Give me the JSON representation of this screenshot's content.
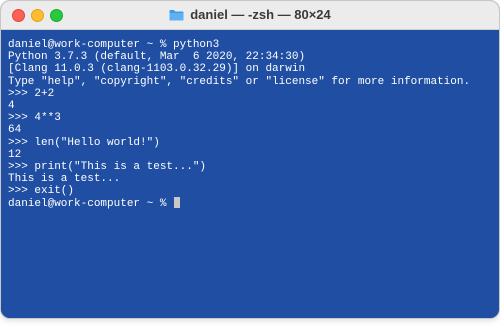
{
  "window": {
    "title": "daniel — -zsh — 80×24",
    "title_icon": "folder-icon",
    "background_color": "#1f4ea3",
    "text_color": "#ffffff"
  },
  "terminal": {
    "lines": [
      "daniel@work-computer ~ % python3",
      "Python 3.7.3 (default, Mar  6 2020, 22:34:30)",
      "[Clang 11.0.3 (clang-1103.0.32.29)] on darwin",
      "Type \"help\", \"copyright\", \"credits\" or \"license\" for more information.",
      ">>> 2+2",
      "4",
      ">>> 4**3",
      "64",
      ">>> len(\"Hello world!\")",
      "12",
      ">>> print(\"This is a test...\")",
      "This is a test...",
      ">>> exit()"
    ],
    "prompt": "daniel@work-computer ~ % "
  }
}
